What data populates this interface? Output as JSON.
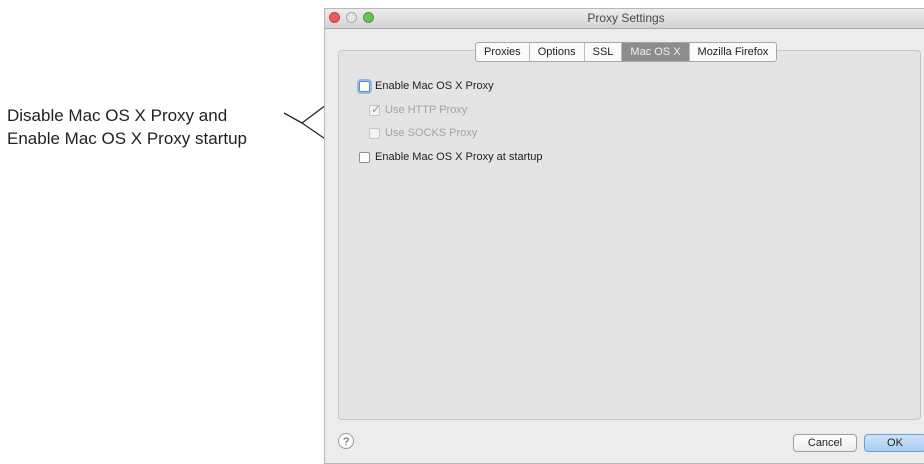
{
  "annotation": {
    "line1": "Disable Mac OS X Proxy and",
    "line2": "Enable Mac OS X Proxy startup"
  },
  "window": {
    "title": "Proxy Settings",
    "tabs": [
      {
        "label": "Proxies",
        "active": false
      },
      {
        "label": "Options",
        "active": false
      },
      {
        "label": "SSL",
        "active": false
      },
      {
        "label": "Mac OS X",
        "active": true
      },
      {
        "label": "Mozilla Firefox",
        "active": false
      }
    ],
    "options": {
      "enable_proxy": {
        "label": "Enable Mac OS X Proxy",
        "checked": false,
        "enabled": true
      },
      "use_http": {
        "label": "Use HTTP Proxy",
        "checked": true,
        "enabled": false
      },
      "use_socks": {
        "label": "Use SOCKS Proxy",
        "checked": false,
        "enabled": false
      },
      "enable_startup": {
        "label": "Enable Mac OS X Proxy at startup",
        "checked": false,
        "enabled": true
      }
    },
    "help_glyph": "?",
    "buttons": {
      "cancel": "Cancel",
      "ok": "OK"
    }
  }
}
